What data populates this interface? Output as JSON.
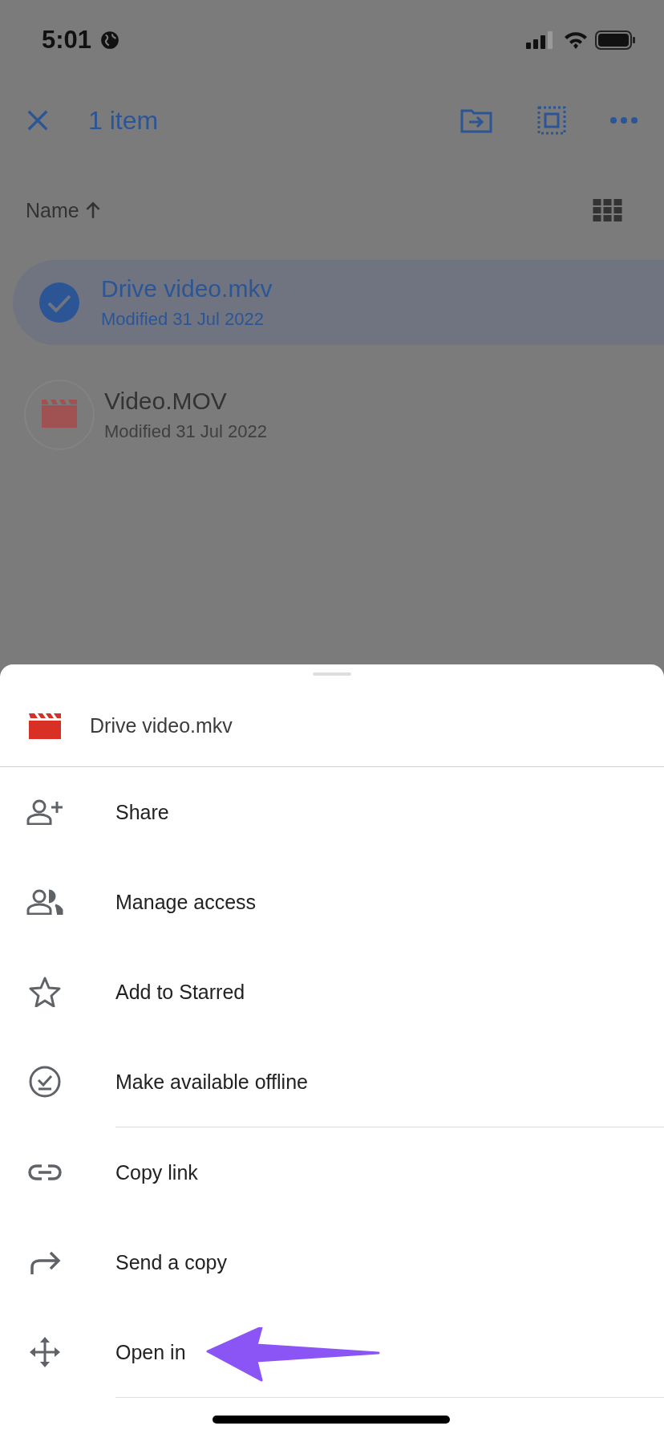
{
  "status_bar": {
    "time": "5:01"
  },
  "toolbar": {
    "title": "1 item"
  },
  "sort": {
    "label": "Name"
  },
  "files": [
    {
      "name": "Drive video.mkv",
      "modified": "Modified 31 Jul 2022",
      "selected": true
    },
    {
      "name": "Video.MOV",
      "modified": "Modified 31 Jul 2022",
      "selected": false
    }
  ],
  "sheet": {
    "title": "Drive video.mkv",
    "groups": [
      [
        {
          "label": "Share",
          "kind": "share"
        },
        {
          "label": "Manage access",
          "kind": "access"
        },
        {
          "label": "Add to Starred",
          "kind": "star"
        },
        {
          "label": "Make available offline",
          "kind": "offline"
        }
      ],
      [
        {
          "label": "Copy link",
          "kind": "link"
        },
        {
          "label": "Send a copy",
          "kind": "send"
        },
        {
          "label": "Open in",
          "kind": "open"
        }
      ]
    ]
  }
}
